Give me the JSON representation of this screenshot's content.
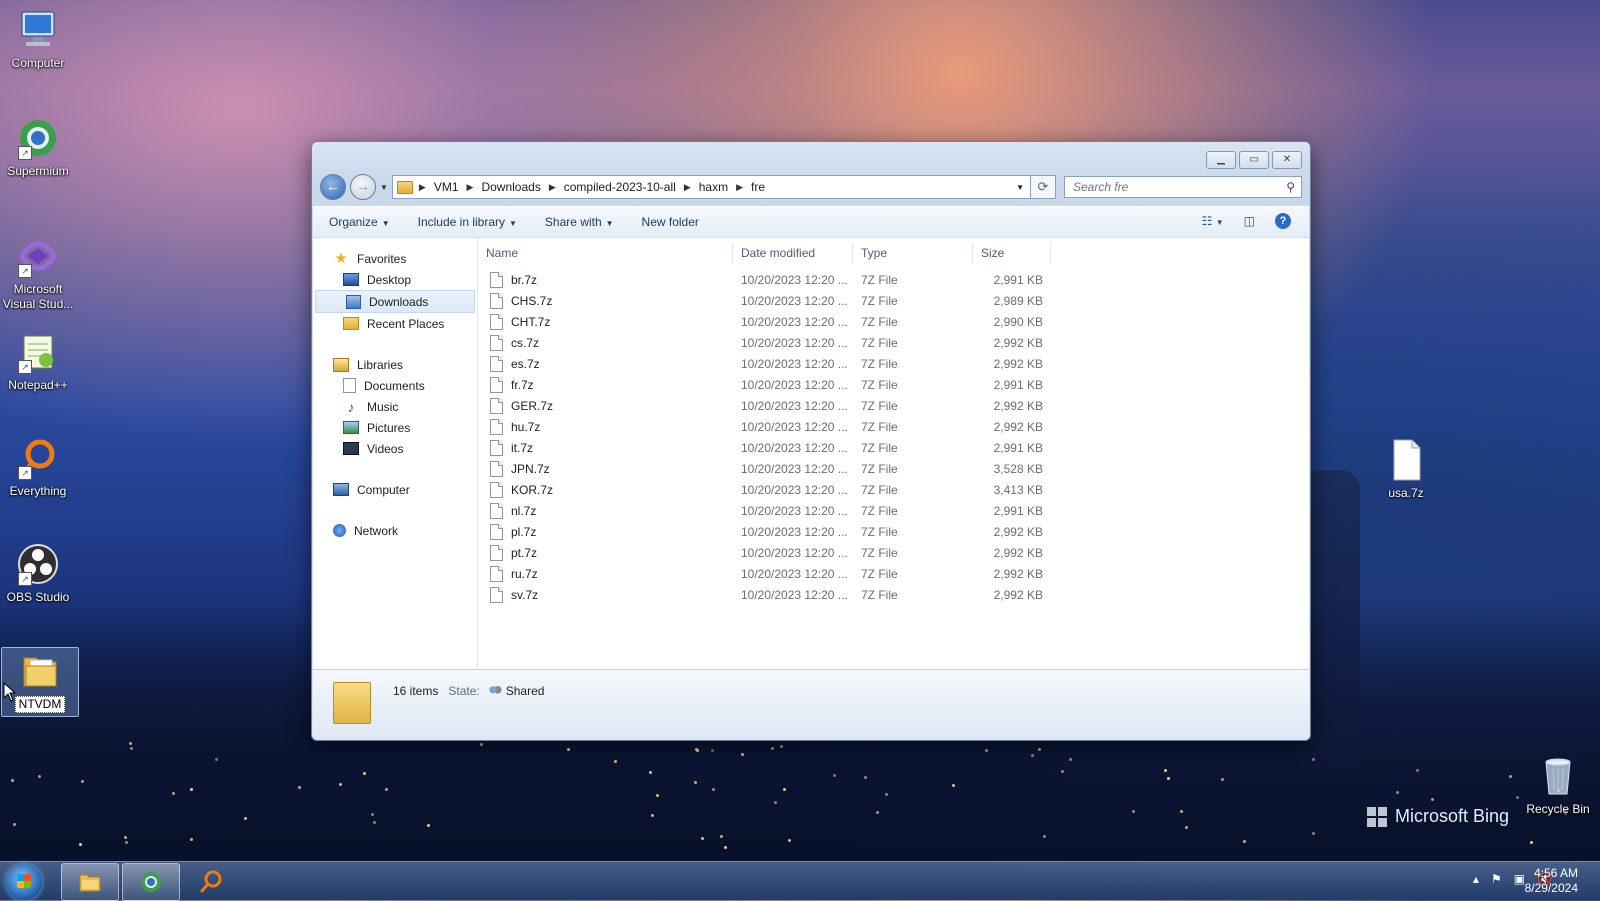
{
  "desktop": {
    "icons": [
      {
        "label": "Computer",
        "icon": "computer-icon"
      },
      {
        "label": "Supermium",
        "icon": "supermium-icon"
      },
      {
        "label": "Microsoft Visual Stud...",
        "icon": "visual-studio-icon"
      },
      {
        "label": "Notepad++",
        "icon": "notepad-plus-plus-icon"
      },
      {
        "label": "Everything",
        "icon": "everything-search-icon"
      },
      {
        "label": "OBS Studio",
        "icon": "obs-studio-icon"
      },
      {
        "label": "NTVDM",
        "icon": "folder-icon"
      }
    ],
    "right_icons": [
      {
        "label": "usa.7z",
        "icon": "file-icon"
      },
      {
        "label": "Recycle Bin",
        "icon": "recycle-bin-icon"
      }
    ],
    "watermark": "Microsoft Bing"
  },
  "explorer": {
    "breadcrumb": [
      "VM1",
      "Downloads",
      "compiled-2023-10-all",
      "haxm",
      "fre"
    ],
    "search_placeholder": "Search fre",
    "toolbar": {
      "organize": "Organize",
      "include_in_library": "Include in library",
      "share_with": "Share with",
      "new_folder": "New folder"
    },
    "nav": {
      "favorites": "Favorites",
      "desktop": "Desktop",
      "downloads": "Downloads",
      "recent_places": "Recent Places",
      "libraries": "Libraries",
      "documents": "Documents",
      "music": "Music",
      "pictures": "Pictures",
      "videos": "Videos",
      "computer": "Computer",
      "network": "Network"
    },
    "columns": {
      "name": "Name",
      "date": "Date modified",
      "type": "Type",
      "size": "Size"
    },
    "files": [
      {
        "name": "br.7z",
        "date": "10/20/2023 12:20 ...",
        "type": "7Z File",
        "size": "2,991 KB"
      },
      {
        "name": "CHS.7z",
        "date": "10/20/2023 12:20 ...",
        "type": "7Z File",
        "size": "2,989 KB"
      },
      {
        "name": "CHT.7z",
        "date": "10/20/2023 12:20 ...",
        "type": "7Z File",
        "size": "2,990 KB"
      },
      {
        "name": "cs.7z",
        "date": "10/20/2023 12:20 ...",
        "type": "7Z File",
        "size": "2,992 KB"
      },
      {
        "name": "es.7z",
        "date": "10/20/2023 12:20 ...",
        "type": "7Z File",
        "size": "2,992 KB"
      },
      {
        "name": "fr.7z",
        "date": "10/20/2023 12:20 ...",
        "type": "7Z File",
        "size": "2,991 KB"
      },
      {
        "name": "GER.7z",
        "date": "10/20/2023 12:20 ...",
        "type": "7Z File",
        "size": "2,992 KB"
      },
      {
        "name": "hu.7z",
        "date": "10/20/2023 12:20 ...",
        "type": "7Z File",
        "size": "2,992 KB"
      },
      {
        "name": "it.7z",
        "date": "10/20/2023 12:20 ...",
        "type": "7Z File",
        "size": "2,991 KB"
      },
      {
        "name": "JPN.7z",
        "date": "10/20/2023 12:20 ...",
        "type": "7Z File",
        "size": "3,528 KB"
      },
      {
        "name": "KOR.7z",
        "date": "10/20/2023 12:20 ...",
        "type": "7Z File",
        "size": "3,413 KB"
      },
      {
        "name": "nl.7z",
        "date": "10/20/2023 12:20 ...",
        "type": "7Z File",
        "size": "2,991 KB"
      },
      {
        "name": "pl.7z",
        "date": "10/20/2023 12:20 ...",
        "type": "7Z File",
        "size": "2,992 KB"
      },
      {
        "name": "pt.7z",
        "date": "10/20/2023 12:20 ...",
        "type": "7Z File",
        "size": "2,992 KB"
      },
      {
        "name": "ru.7z",
        "date": "10/20/2023 12:20 ...",
        "type": "7Z File",
        "size": "2,992 KB"
      },
      {
        "name": "sv.7z",
        "date": "10/20/2023 12:20 ...",
        "type": "7Z File",
        "size": "2,992 KB"
      }
    ],
    "details": {
      "count": "16 items",
      "state_label": "State:",
      "state_value": "Shared"
    }
  },
  "taskbar": {
    "time": "4:56 AM",
    "date": "8/29/2024"
  }
}
